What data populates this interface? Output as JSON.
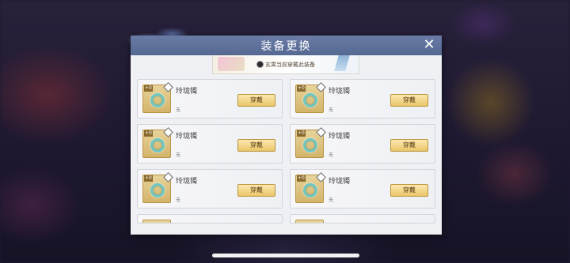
{
  "dialog": {
    "title": "装备更换",
    "close_glyph": "✕",
    "top_card_text": "玄霄当前穿戴此装备"
  },
  "items": [
    {
      "level": "+0",
      "name": "玲珑镯",
      "sub": "无",
      "button": "穿戴"
    },
    {
      "level": "+0",
      "name": "玲珑镯",
      "sub": "无",
      "button": "穿戴"
    },
    {
      "level": "+0",
      "name": "玲珑镯",
      "sub": "无",
      "button": "穿戴"
    },
    {
      "level": "+0",
      "name": "玲珑镯",
      "sub": "无",
      "button": "穿戴"
    },
    {
      "level": "+0",
      "name": "玲珑镯",
      "sub": "无",
      "button": "穿戴"
    },
    {
      "level": "+0",
      "name": "玲珑镯",
      "sub": "无",
      "button": "穿戴"
    }
  ],
  "colors": {
    "titlebar": "#556892",
    "button_gold": "#eac66a",
    "ring_jade": "#6fc7c2"
  },
  "icons": {
    "close": "close-icon",
    "item": "bracelet-icon",
    "wearer": "avatar-icon"
  }
}
